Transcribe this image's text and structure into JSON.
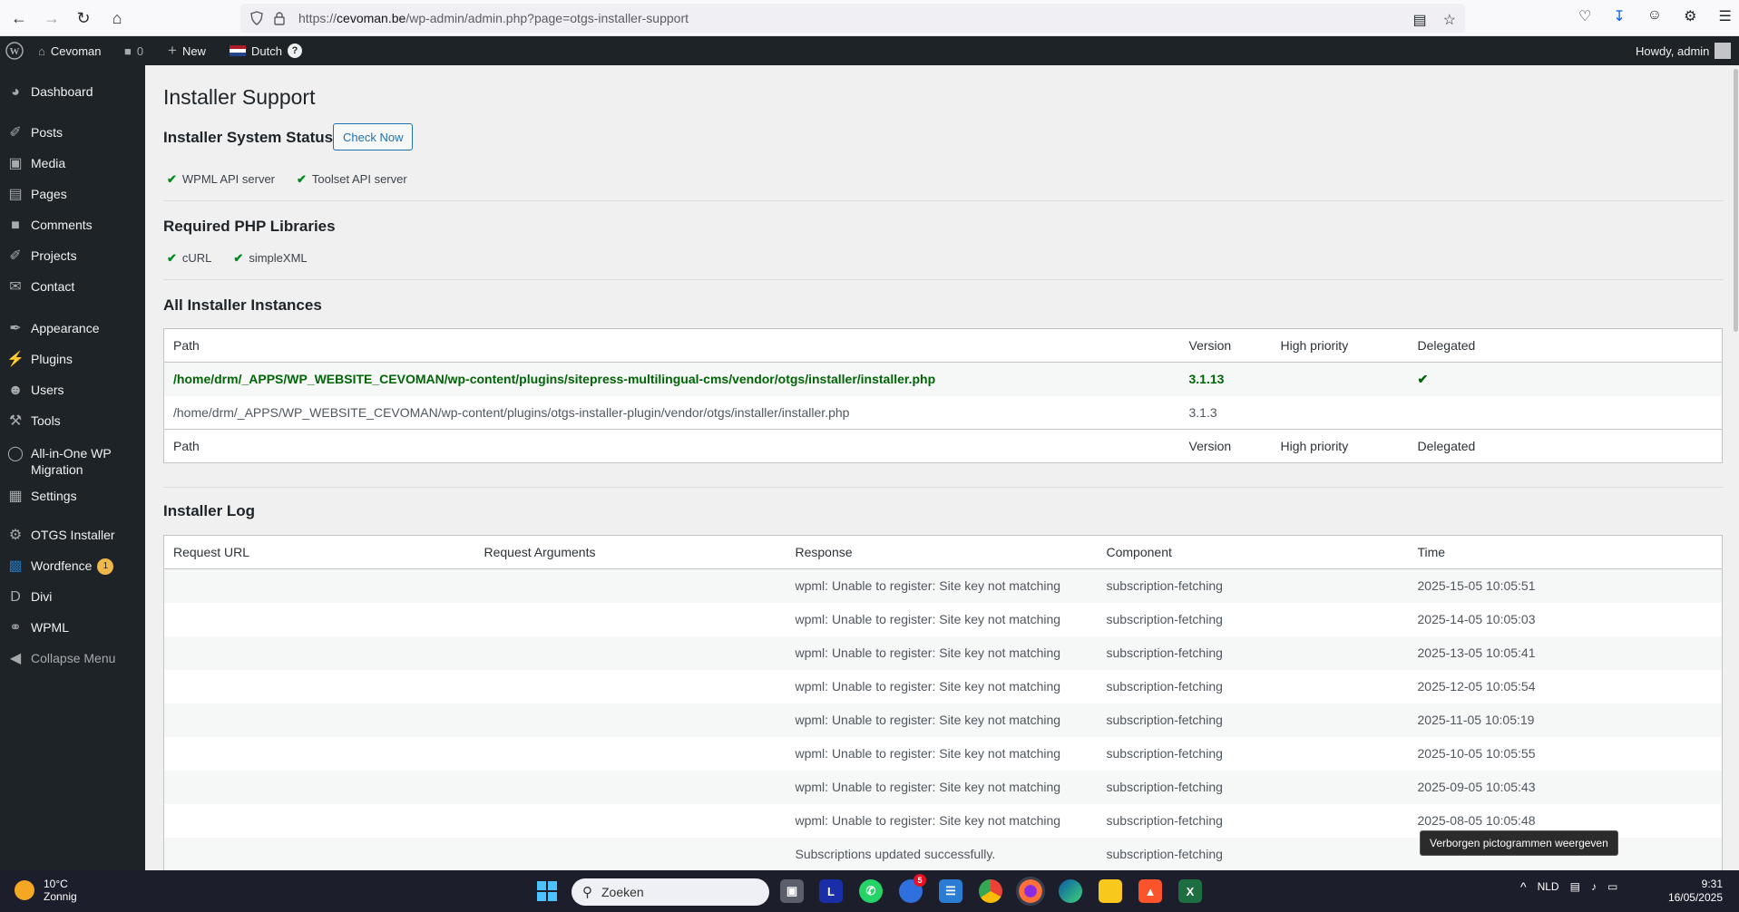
{
  "browser": {
    "url_prefix": "https://",
    "url_domain": "cevoman.be",
    "url_path": "/wp-admin/admin.php?page=otgs-installer-support"
  },
  "adminbar": {
    "site_name": "Cevoman",
    "comments_count": "0",
    "new_label": "New",
    "language": "Dutch",
    "help": "?",
    "howdy": "Howdy, admin"
  },
  "sidebar": {
    "items": [
      {
        "label": "Dashboard",
        "icon": "dashboard-icon"
      },
      {
        "label": "Posts",
        "icon": "pin-icon"
      },
      {
        "label": "Media",
        "icon": "media-icon"
      },
      {
        "label": "Pages",
        "icon": "pages-icon"
      },
      {
        "label": "Comments",
        "icon": "comment-icon"
      },
      {
        "label": "Projects",
        "icon": "pin-icon"
      },
      {
        "label": "Contact",
        "icon": "mail-icon"
      },
      {
        "label": "Appearance",
        "icon": "brush-icon"
      },
      {
        "label": "Plugins",
        "icon": "plugin-icon"
      },
      {
        "label": "Users",
        "icon": "user-icon"
      },
      {
        "label": "Tools",
        "icon": "wrench-icon"
      },
      {
        "label": "All-in-One WP Migration",
        "icon": "migration-icon"
      },
      {
        "label": "Settings",
        "icon": "settings-icon"
      },
      {
        "label": "OTGS Installer",
        "icon": "gear-icon"
      },
      {
        "label": "Wordfence",
        "icon": "wordfence-icon",
        "badge": "1"
      },
      {
        "label": "Divi",
        "icon": "divi-icon"
      },
      {
        "label": "WPML",
        "icon": "wpml-icon"
      },
      {
        "label": "Collapse Menu",
        "icon": "collapse-icon"
      }
    ]
  },
  "page": {
    "title": "Installer Support",
    "system_status_title": "Installer System Status",
    "check_now": "Check Now",
    "status_items": [
      "WPML API server",
      "Toolset API server"
    ],
    "php_title": "Required PHP Libraries",
    "php_items": [
      "cURL",
      "simpleXML"
    ],
    "instances_title": "All Installer Instances",
    "log_title": "Installer Log"
  },
  "instances_table": {
    "columns": [
      "Path",
      "Version",
      "High priority",
      "Delegated"
    ],
    "rows": [
      {
        "path": "/home/drm/_APPS/WP_WEBSITE_CEVOMAN/wp-content/plugins/sitepress-multilingual-cms/vendor/otgs/installer/installer.php",
        "version": "3.1.13",
        "high_priority": "",
        "delegated": "✔"
      },
      {
        "path": "/home/drm/_APPS/WP_WEBSITE_CEVOMAN/wp-content/plugins/otgs-installer-plugin/vendor/otgs/installer/installer.php",
        "version": "3.1.3",
        "high_priority": "",
        "delegated": ""
      }
    ]
  },
  "log_table": {
    "columns": [
      "Request URL",
      "Request Arguments",
      "Response",
      "Component",
      "Time"
    ],
    "rows": [
      {
        "url": "",
        "args": "",
        "response": "wpml: Unable to register: Site key not matching",
        "component": "subscription-fetching",
        "time": "2025-15-05 10:05:51"
      },
      {
        "url": "",
        "args": "",
        "response": "wpml: Unable to register: Site key not matching",
        "component": "subscription-fetching",
        "time": "2025-14-05 10:05:03"
      },
      {
        "url": "",
        "args": "",
        "response": "wpml: Unable to register: Site key not matching",
        "component": "subscription-fetching",
        "time": "2025-13-05 10:05:41"
      },
      {
        "url": "",
        "args": "",
        "response": "wpml: Unable to register: Site key not matching",
        "component": "subscription-fetching",
        "time": "2025-12-05 10:05:54"
      },
      {
        "url": "",
        "args": "",
        "response": "wpml: Unable to register: Site key not matching",
        "component": "subscription-fetching",
        "time": "2025-11-05 10:05:19"
      },
      {
        "url": "",
        "args": "",
        "response": "wpml: Unable to register: Site key not matching",
        "component": "subscription-fetching",
        "time": "2025-10-05 10:05:55"
      },
      {
        "url": "",
        "args": "",
        "response": "wpml: Unable to register: Site key not matching",
        "component": "subscription-fetching",
        "time": "2025-09-05 10:05:43"
      },
      {
        "url": "",
        "args": "",
        "response": "wpml: Unable to register: Site key not matching",
        "component": "subscription-fetching",
        "time": "2025-08-05 10:05:48"
      },
      {
        "url": "",
        "args": "",
        "response": "Subscriptions updated successfully.",
        "component": "subscription-fetching",
        "time": ""
      }
    ]
  },
  "tooltip": "Verborgen pictogrammen weergeven",
  "taskbar": {
    "temperature": "10°C",
    "weather": "Zonnig",
    "search_placeholder": "Zoeken",
    "notification_badge": "5",
    "language": "NLD",
    "time": "9:31",
    "date": "16/05/2025"
  },
  "colors": {
    "admin_dark": "#1d2327",
    "link_blue": "#2271b1",
    "success_green": "#006505",
    "taskbar": "#1c1f2b"
  }
}
